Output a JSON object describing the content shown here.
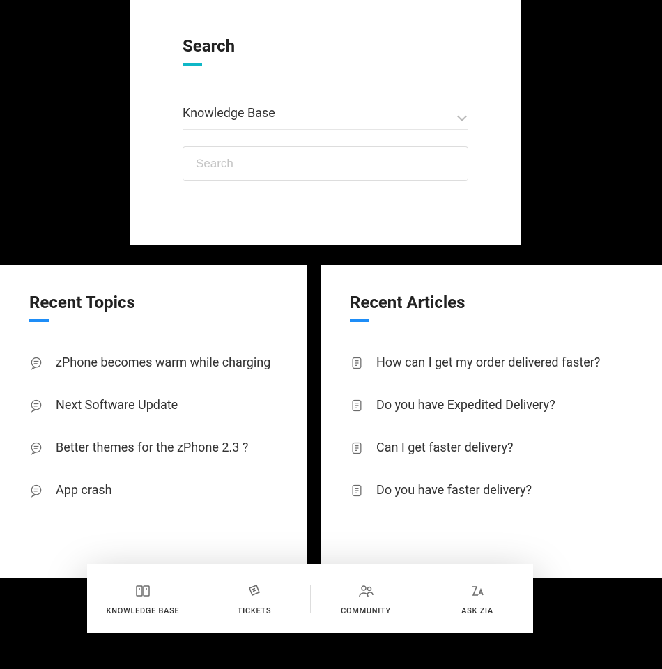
{
  "search": {
    "title": "Search",
    "select_label": "Knowledge Base",
    "placeholder": "Search"
  },
  "topics": {
    "title": "Recent Topics",
    "items": [
      "zPhone becomes warm while charging",
      "Next Software Update",
      "Better themes for the zPhone 2.3 ?",
      "App crash"
    ]
  },
  "articles": {
    "title": "Recent Articles",
    "items": [
      "How can I get my order delivered faster?",
      "Do you have Expedited Delivery?",
      "Can I get faster delivery?",
      "Do you have faster delivery?"
    ]
  },
  "nav": {
    "items": [
      "KNOWLEDGE BASE",
      "TICKETS",
      "COMMUNITY",
      "ASK ZIA"
    ]
  }
}
